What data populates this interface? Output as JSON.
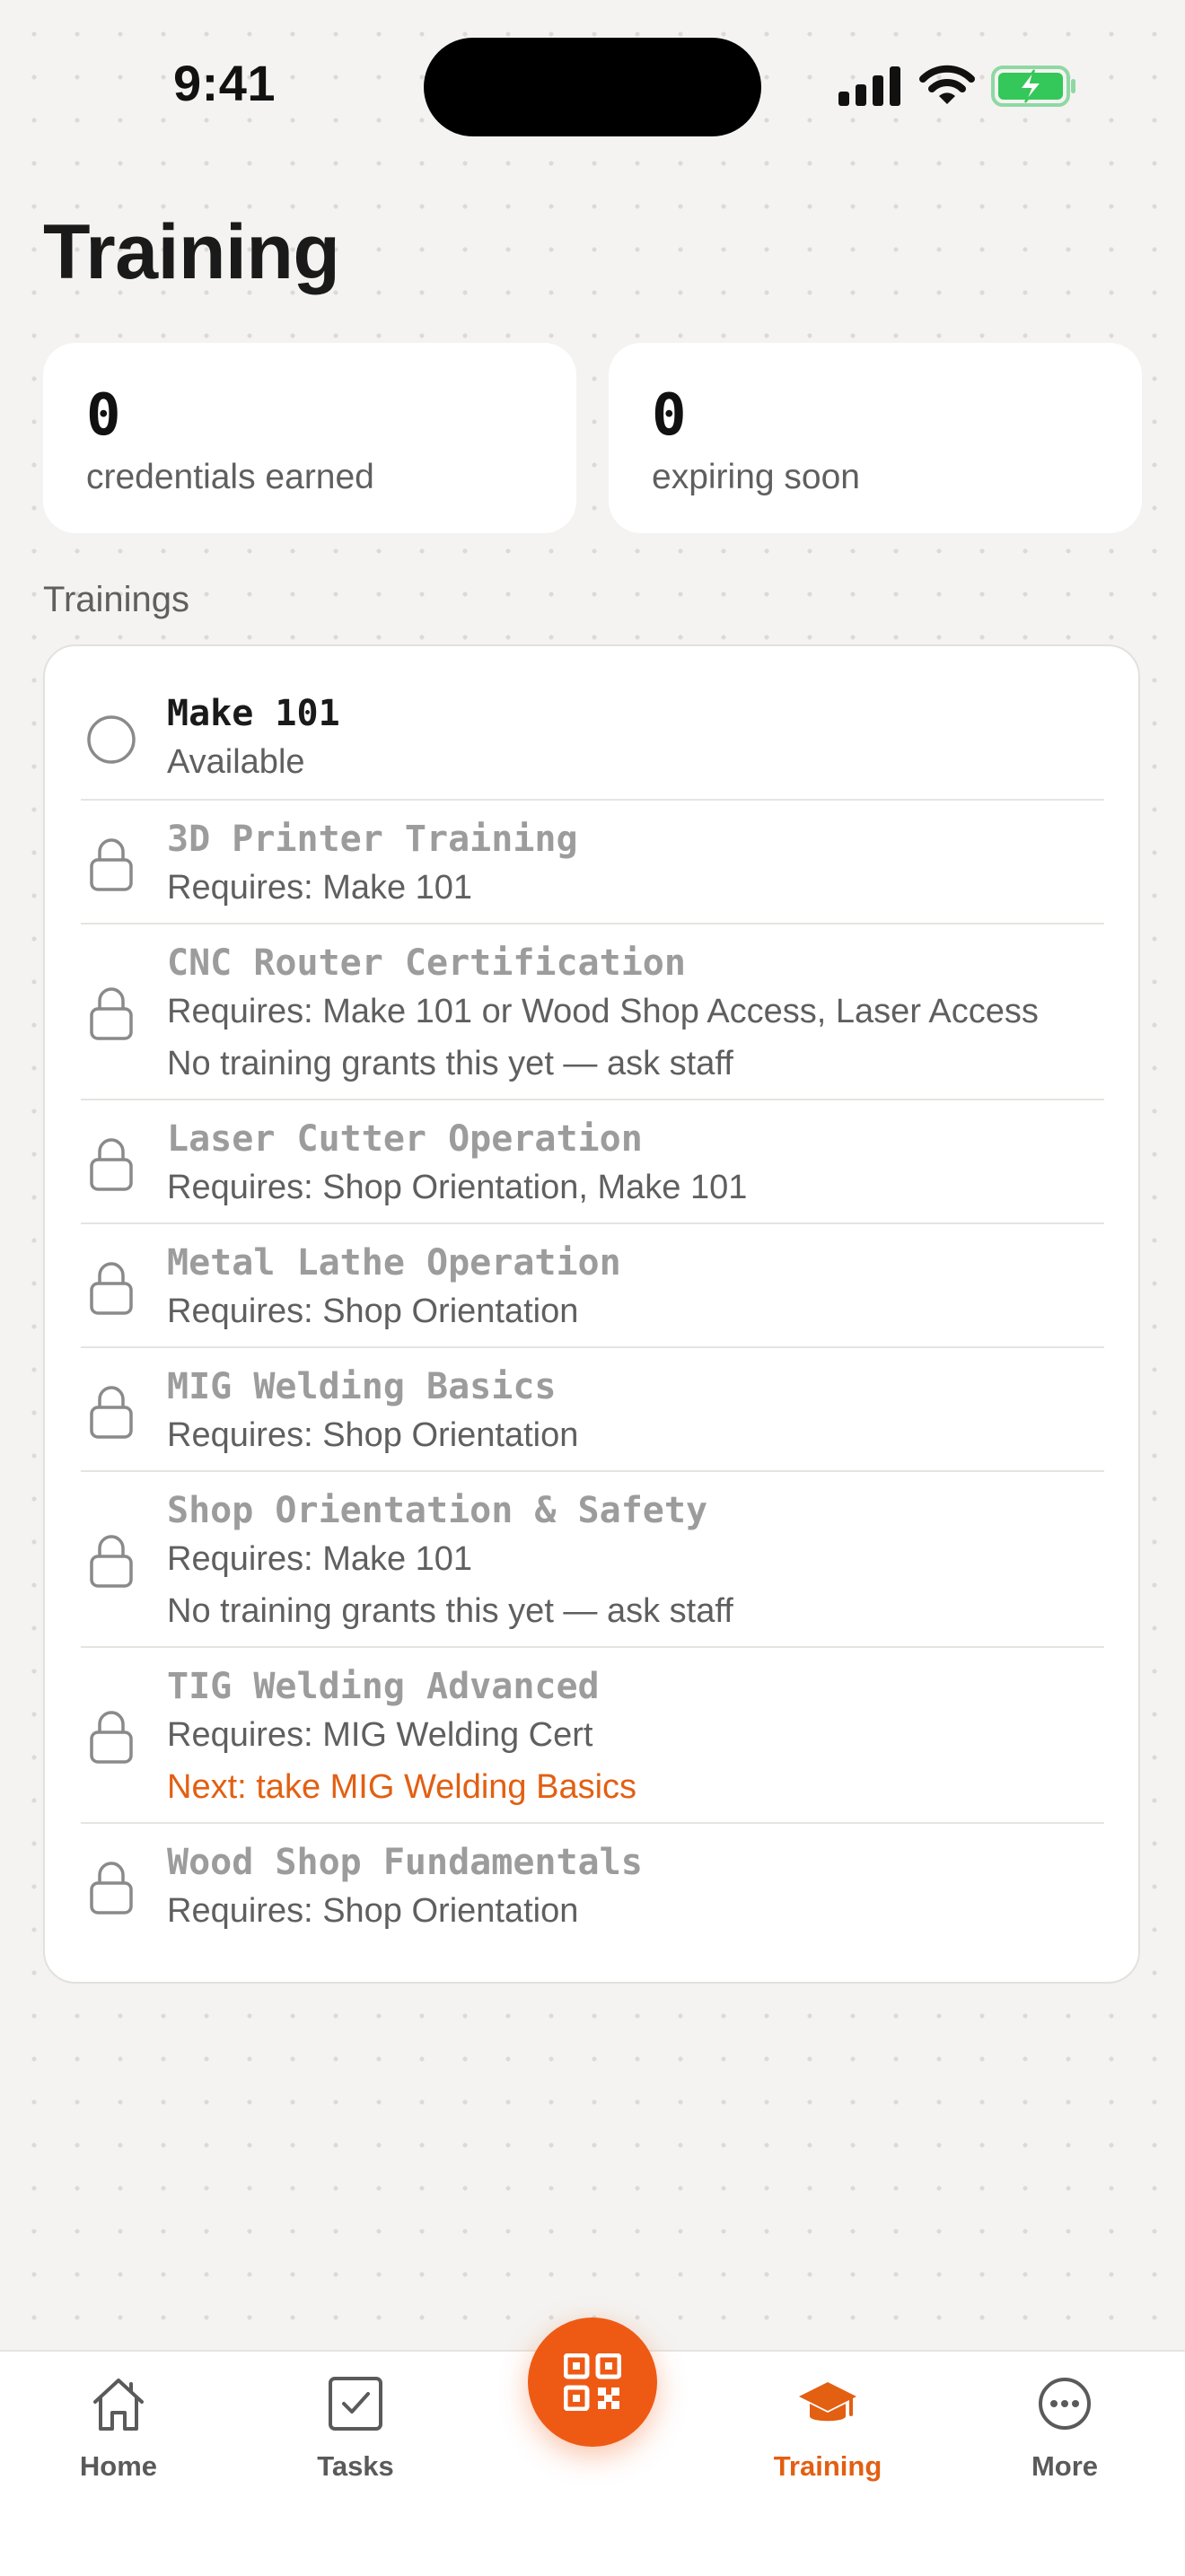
{
  "status_bar": {
    "time": "9:41",
    "icons": [
      "cellular-signal-icon",
      "wifi-icon",
      "battery-charging-icon"
    ]
  },
  "page": {
    "title": "Training"
  },
  "stats": [
    {
      "value": "0",
      "label": "credentials earned"
    },
    {
      "value": "0",
      "label": "expiring soon"
    }
  ],
  "trainings_section": {
    "heading": "Trainings",
    "items": [
      {
        "name": "Make 101",
        "status": "available",
        "icon": "circle-icon",
        "lines": [
          "Available"
        ]
      },
      {
        "name": "3D Printer Training",
        "status": "locked",
        "icon": "lock-icon",
        "lines": [
          "Requires: Make 101"
        ]
      },
      {
        "name": "CNC Router Certification",
        "status": "locked",
        "icon": "lock-icon",
        "lines": [
          "Requires: Make 101 or Wood Shop Access, Laser Access",
          "No training grants this yet — ask staff"
        ]
      },
      {
        "name": "Laser Cutter Operation",
        "status": "locked",
        "icon": "lock-icon",
        "lines": [
          "Requires: Shop Orientation, Make 101"
        ]
      },
      {
        "name": "Metal Lathe Operation",
        "status": "locked",
        "icon": "lock-icon",
        "lines": [
          "Requires: Shop Orientation"
        ]
      },
      {
        "name": "MIG Welding Basics",
        "status": "locked",
        "icon": "lock-icon",
        "lines": [
          "Requires: Shop Orientation"
        ]
      },
      {
        "name": "Shop Orientation & Safety",
        "status": "locked",
        "icon": "lock-icon",
        "lines": [
          "Requires: Make 101",
          "No training grants this yet — ask staff"
        ]
      },
      {
        "name": "TIG Welding Advanced",
        "status": "locked",
        "icon": "lock-icon",
        "lines": [
          "Requires: MIG Welding Cert",
          "Next: take MIG Welding Basics"
        ]
      },
      {
        "name": "Wood Shop Fundamentals",
        "status": "locked",
        "icon": "lock-icon",
        "lines": [
          "Requires: Shop Orientation"
        ]
      }
    ]
  },
  "tab_bar": {
    "tabs": [
      {
        "label": "Home",
        "icon": "home-icon",
        "active": false
      },
      {
        "label": "Tasks",
        "icon": "checkbox-icon",
        "active": false
      },
      {
        "label": "Training",
        "icon": "graduation-cap-icon",
        "active": true
      },
      {
        "label": "More",
        "icon": "more-icon",
        "active": false
      }
    ],
    "center_button_icon": "qr-code-icon"
  },
  "colors": {
    "accent": "#EE5A14",
    "background": "#F4F3F1",
    "card": "#FFFFFF",
    "muted_text": "#5F5F5F",
    "locked_text": "#9C9C9C",
    "battery": "#34C759"
  }
}
